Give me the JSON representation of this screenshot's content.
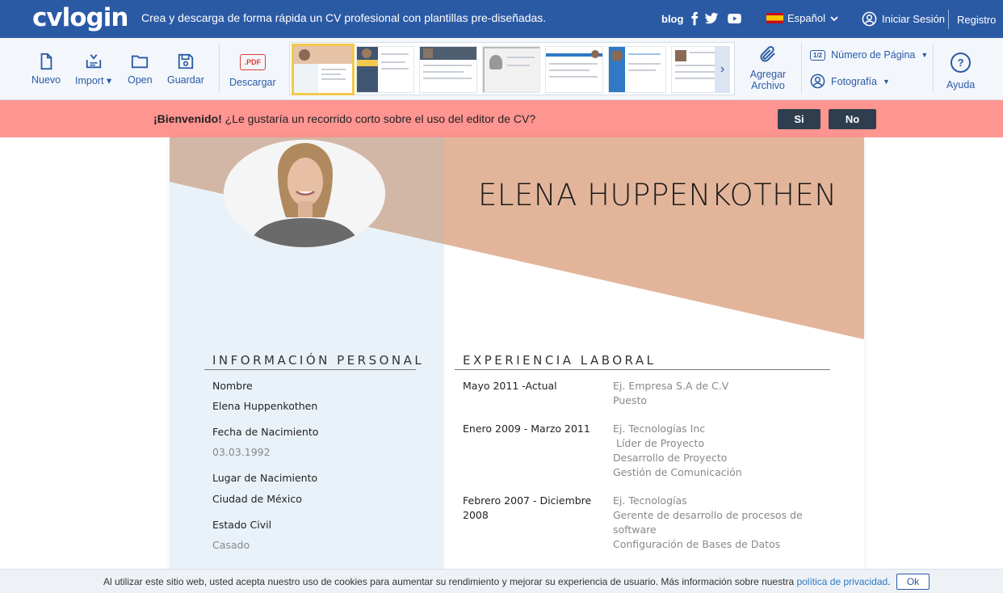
{
  "header": {
    "logo": "cvlogin",
    "tagline": "Crea y descarga de forma rápida un CV profesional con plantillas pre-diseñadas.",
    "blog": "blog",
    "language": "Español",
    "login": "Iniciar Sesión",
    "register": "Registro"
  },
  "toolbar": {
    "new": "Nuevo",
    "import": "Import",
    "open": "Open",
    "save": "Guardar",
    "download": "Descargar",
    "pdf_badge": ".PDF",
    "attach_line1": "Agregar",
    "attach_line2": "Archivo",
    "page_number": "Número de Página",
    "page_number_badge": "1/2",
    "photo": "Fotografía",
    "help": "Ayuda",
    "help_symbol": "?"
  },
  "banner": {
    "bold": "¡Bienvenido!",
    "text": " ¿Le gustaría un recorrido corto sobre el uso del editor de CV?",
    "yes": "Si",
    "no": "No"
  },
  "colors": {
    "brand_blue": "#2b5aa5",
    "banner_red": "#ff9591",
    "cv_peach": "#e2b59a",
    "cv_blue": "#eaf2f9"
  },
  "cv": {
    "name": "ELENA HUPPENKOTHEN",
    "personal": {
      "title": "INFORMACIÓN PERSONAL",
      "name_label": "Nombre",
      "name_value": "Elena Huppenkothen",
      "dob_label": "Fecha de Nacimiento",
      "dob_value": "03.03.1992",
      "pob_label": "Lugar de Nacimiento",
      "pob_value": "Ciudad de México",
      "civil_label": "Estado Civil",
      "civil_value": "Casado"
    },
    "experience": {
      "title": "EXPERIENCIA LABORAL",
      "items": [
        {
          "date": "Mayo 2011 -Actual",
          "lines": [
            "Ej. Empresa S.A de C.V",
            "Puesto"
          ]
        },
        {
          "date": "Enero 2009 - Marzo 2011",
          "lines": [
            "Ej. Tecnologías Inc",
            " Líder de Proyecto",
            "Desarrollo de Proyecto",
            "Gestión de Comunicación"
          ]
        },
        {
          "date": "Febrero 2007 - Diciembre 2008",
          "lines": [
            "Ej. Tecnologías",
            "Gerente de desarrollo de procesos de software",
            "Configuración de Bases de Datos"
          ]
        }
      ]
    }
  },
  "cookie": {
    "text": "Al utilizar este sitio web, usted acepta nuestro uso de cookies para aumentar su rendimiento y mejorar su experiencia de usuario. Más información sobre nuestra ",
    "link": "política de privacidad",
    "period": ".",
    "ok": "Ok"
  }
}
